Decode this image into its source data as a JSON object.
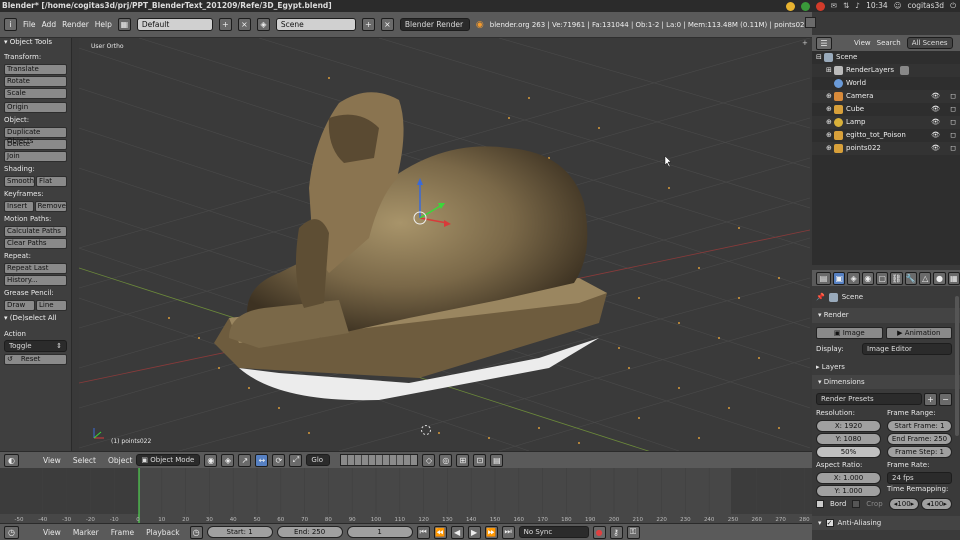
{
  "topbar": {
    "title": "Blender* [/home/cogitas3d/prj/PPT_BlenderText_201209/Refe/3D_Egypt.blend]",
    "clock": "10:34",
    "user": "cogitas3d"
  },
  "menubar": {
    "items": [
      "File",
      "Add",
      "Render",
      "Help"
    ],
    "layout": "Default",
    "scene": "Scene",
    "engine": "Blender Render",
    "stats": "blender.org 263 | Ve:71961 | Fa:131044 | Ob:1-2 | La:0 | Mem:113.48M (0.11M) | points022"
  },
  "toolshelf": {
    "title": "Object Tools",
    "transform_label": "Transform:",
    "translate": "Translate",
    "rotate": "Rotate",
    "scale": "Scale",
    "origin": "Origin",
    "object_label": "Object:",
    "duplicate": "Duplicate Objects",
    "delete": "Delete",
    "join": "Join",
    "shading_label": "Shading:",
    "smooth": "Smooth",
    "flat": "Flat",
    "keyframes_label": "Keyframes:",
    "insert": "Insert",
    "remove": "Remove",
    "motion_label": "Motion Paths:",
    "calc_paths": "Calculate Paths",
    "clear_paths": "Clear Paths",
    "repeat_label": "Repeat:",
    "repeat_last": "Repeat Last",
    "history": "History...",
    "grease_label": "Grease Pencil:",
    "draw": "Draw",
    "line": "Line",
    "deselect": "(De)select All",
    "action_label": "Action",
    "action_value": "Toggle",
    "reset": "Reset"
  },
  "viewport": {
    "view_label": "User Ortho",
    "object_label": "(1) points022"
  },
  "viewport_header": {
    "menus": [
      "View",
      "Select",
      "Object"
    ],
    "mode": "Object Mode",
    "orientation": "Glo"
  },
  "timeline": {
    "ticks": [
      "-50",
      "-40",
      "-30",
      "-20",
      "-10",
      "0",
      "10",
      "20",
      "30",
      "40",
      "50",
      "60",
      "70",
      "80",
      "90",
      "100",
      "110",
      "120",
      "130",
      "140",
      "150",
      "160",
      "170",
      "180",
      "190",
      "200",
      "210",
      "220",
      "230",
      "240",
      "250",
      "260",
      "270",
      "280"
    ],
    "menus": [
      "View",
      "Marker",
      "Frame",
      "Playback"
    ],
    "start": "Start: 1",
    "end": "End: 250",
    "current": "1",
    "sync": "No Sync"
  },
  "outliner": {
    "tabs": [
      "View",
      "Search",
      "All Scenes"
    ],
    "items": [
      "Scene",
      "RenderLayers",
      "World",
      "Camera",
      "Cube",
      "Lamp",
      "egitto_tot_Poison",
      "points022"
    ]
  },
  "properties": {
    "scene": "Scene",
    "render_section": "Render",
    "image_btn": "Image",
    "animation_btn": "Animation",
    "display_label": "Display:",
    "display_value": "Image Editor",
    "layers_section": "Layers",
    "dimensions_section": "Dimensions",
    "presets": "Render Presets",
    "resolution_label": "Resolution:",
    "res_x": "X: 1920",
    "res_y": "Y: 1080",
    "res_pct": "50%",
    "frame_range_label": "Frame Range:",
    "start_frame": "Start Frame: 1",
    "end_frame": "End Frame: 250",
    "frame_step": "Frame Step: 1",
    "aspect_label": "Aspect Ratio:",
    "aspect_x": "X: 1.000",
    "aspect_y": "Y: 1.000",
    "frame_rate_label": "Frame Rate:",
    "fps": "24 fps",
    "time_remap_label": "Time Remapping:",
    "remap_old": "100",
    "remap_new": "100",
    "bord": "Bord",
    "crop": "Crop",
    "aa_section": "Anti-Aliasing"
  }
}
